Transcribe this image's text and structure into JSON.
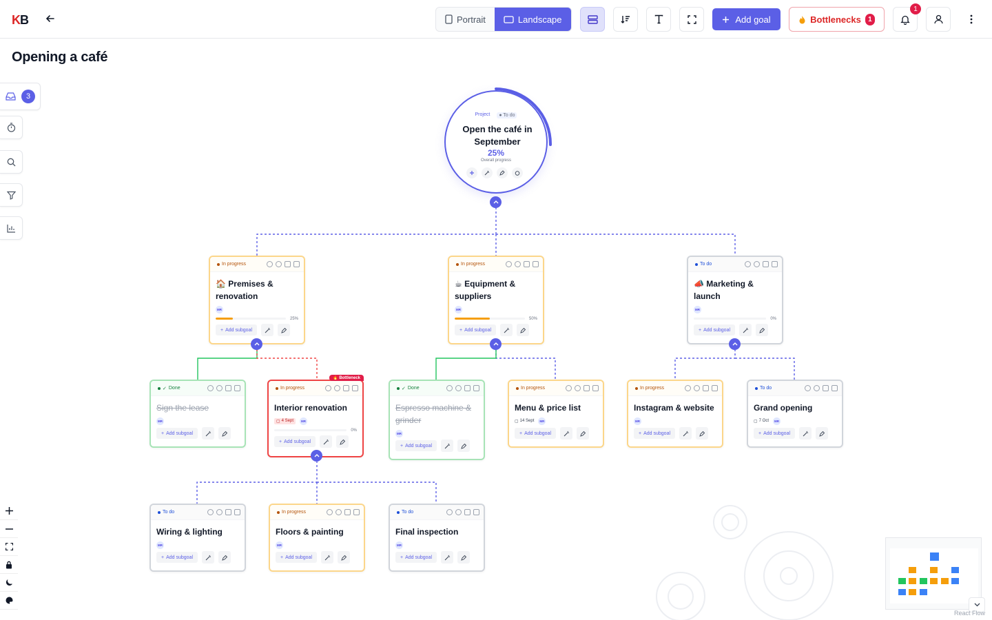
{
  "app": {
    "logo_k": "K",
    "logo_rest": "B"
  },
  "header": {
    "portrait_label": "Portrait",
    "landscape_label": "Landscape",
    "add_goal_label": "Add goal",
    "bottlenecks_label": "Bottlenecks",
    "bottlenecks_count": "1",
    "notifications_count": "1"
  },
  "page": {
    "title": "Opening a café"
  },
  "sidebar": {
    "inbox_count": "3"
  },
  "root": {
    "tag_project": "Project",
    "status": "To do",
    "title": "Open the café in September",
    "percent": "25%",
    "percent_label": "Overall progress",
    "progress": 0.25
  },
  "goals": {
    "premises": {
      "status": "In progress",
      "icon": "🏠",
      "title": "Premises & renovation",
      "avatar": "MR",
      "progress": 0.25,
      "progress_label": "25%",
      "add_label": "Add subgoal"
    },
    "equipment": {
      "status": "In progress",
      "icon": "☕",
      "title": "Equipment & suppliers",
      "avatar": "MR",
      "progress": 0.5,
      "progress_label": "50%",
      "add_label": "Add subgoal"
    },
    "marketing": {
      "status": "To do",
      "icon": "📣",
      "title": "Marketing & launch",
      "avatar": "MR",
      "progress": 0,
      "progress_label": "0%",
      "add_label": "Add subgoal"
    },
    "lease": {
      "status": "Done",
      "title": "Sign the lease",
      "avatar": "MR",
      "add_label": "Add subgoal"
    },
    "interior": {
      "status": "In progress",
      "bottleneck_label": "Bottleneck",
      "title": "Interior renovation",
      "date": "4 Sept",
      "avatar": "MR",
      "progress": 0,
      "progress_label": "0%",
      "add_label": "Add subgoal"
    },
    "espresso": {
      "status": "Done",
      "title": "Espresso machine & grinder",
      "avatar": "MR",
      "add_label": "Add subgoal"
    },
    "menu": {
      "status": "In progress",
      "title": "Menu & price list",
      "date": "14 Sept",
      "avatar": "MR",
      "add_label": "Add subgoal"
    },
    "instagram": {
      "status": "In progress",
      "title": "Instagram & website",
      "avatar": "MR",
      "add_label": "Add subgoal"
    },
    "grand": {
      "status": "To do",
      "title": "Grand opening",
      "date": "7 Oct",
      "avatar": "MR",
      "add_label": "Add subgoal"
    },
    "wiring": {
      "status": "To do",
      "title": "Wiring & lighting",
      "avatar": "MR",
      "add_label": "Add subgoal"
    },
    "floors": {
      "status": "In progress",
      "title": "Floors & painting",
      "avatar": "MR",
      "add_label": "Add subgoal"
    },
    "inspection": {
      "status": "To do",
      "title": "Final inspection",
      "avatar": "MR",
      "add_label": "Add subgoal"
    }
  },
  "minimap": {
    "attribution": "React Flow"
  },
  "colors": {
    "accent": "#5b5fe6",
    "in_progress": "#f59e0b",
    "done": "#22c55e",
    "todo": "#3b82f6",
    "bottleneck": "#e11d48"
  }
}
